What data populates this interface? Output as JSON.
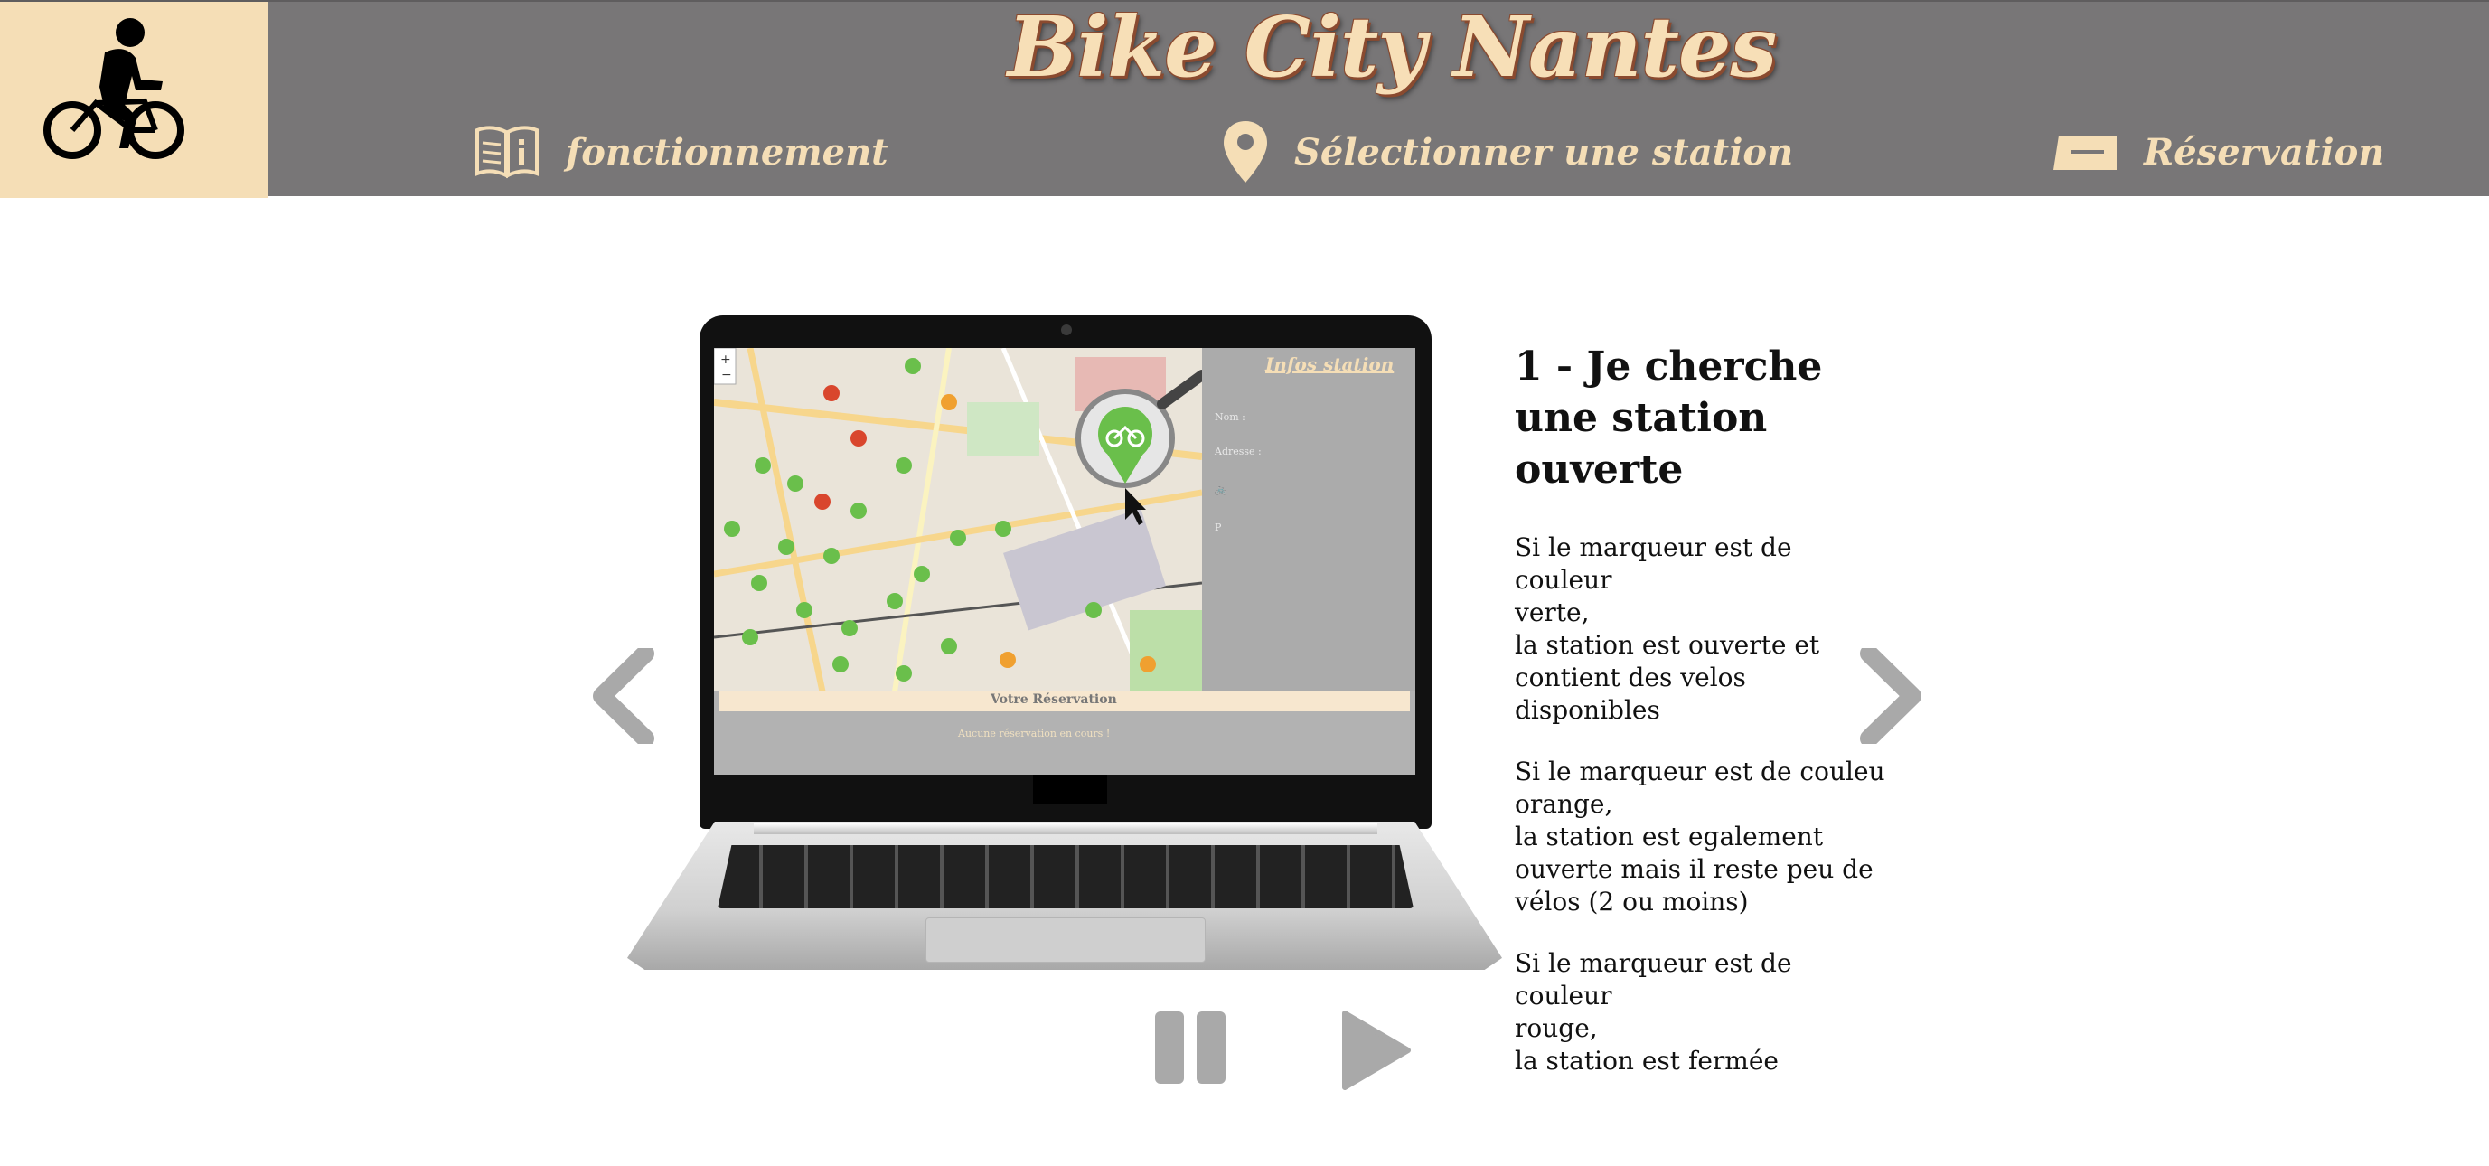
{
  "header": {
    "title": "Bike City Nantes",
    "logo_icon": "cyclist-icon",
    "brand_color": "#f5deb6",
    "header_bg": "#787677"
  },
  "nav": {
    "items": [
      {
        "label": "fonctionnement",
        "icon": "book-info-icon"
      },
      {
        "label": "Sélectionner une station",
        "icon": "map-pin-icon"
      },
      {
        "label": "Réservation",
        "icon": "ticket-icon"
      }
    ]
  },
  "slide": {
    "title": "1 - Je cherche une station ouverte",
    "paragraphs": [
      {
        "lines": [
          "Si le marqueur est de couleur",
          "verte,",
          "la station est ouverte et",
          "contient des velos disponibles"
        ]
      },
      {
        "lines": [
          "Si le marqueur est de couleu",
          "orange,",
          "la station est egalement",
          "ouverte mais il reste peu de",
          "vélos (2 ou moins)"
        ]
      },
      {
        "lines": [
          "Si le marqueur est de couleur",
          "rouge,",
          "la station est fermée"
        ]
      }
    ],
    "screen": {
      "panel_title": "Infos station",
      "reservation_label": "Votre Réservation",
      "reservation_message": "Aucune réservation en cours !"
    }
  },
  "controls": {
    "prev_icon": "chevron-left-icon",
    "next_icon": "chevron-right-icon",
    "pause_icon": "pause-icon",
    "play_icon": "play-icon",
    "control_color": "#a9a9a9"
  }
}
